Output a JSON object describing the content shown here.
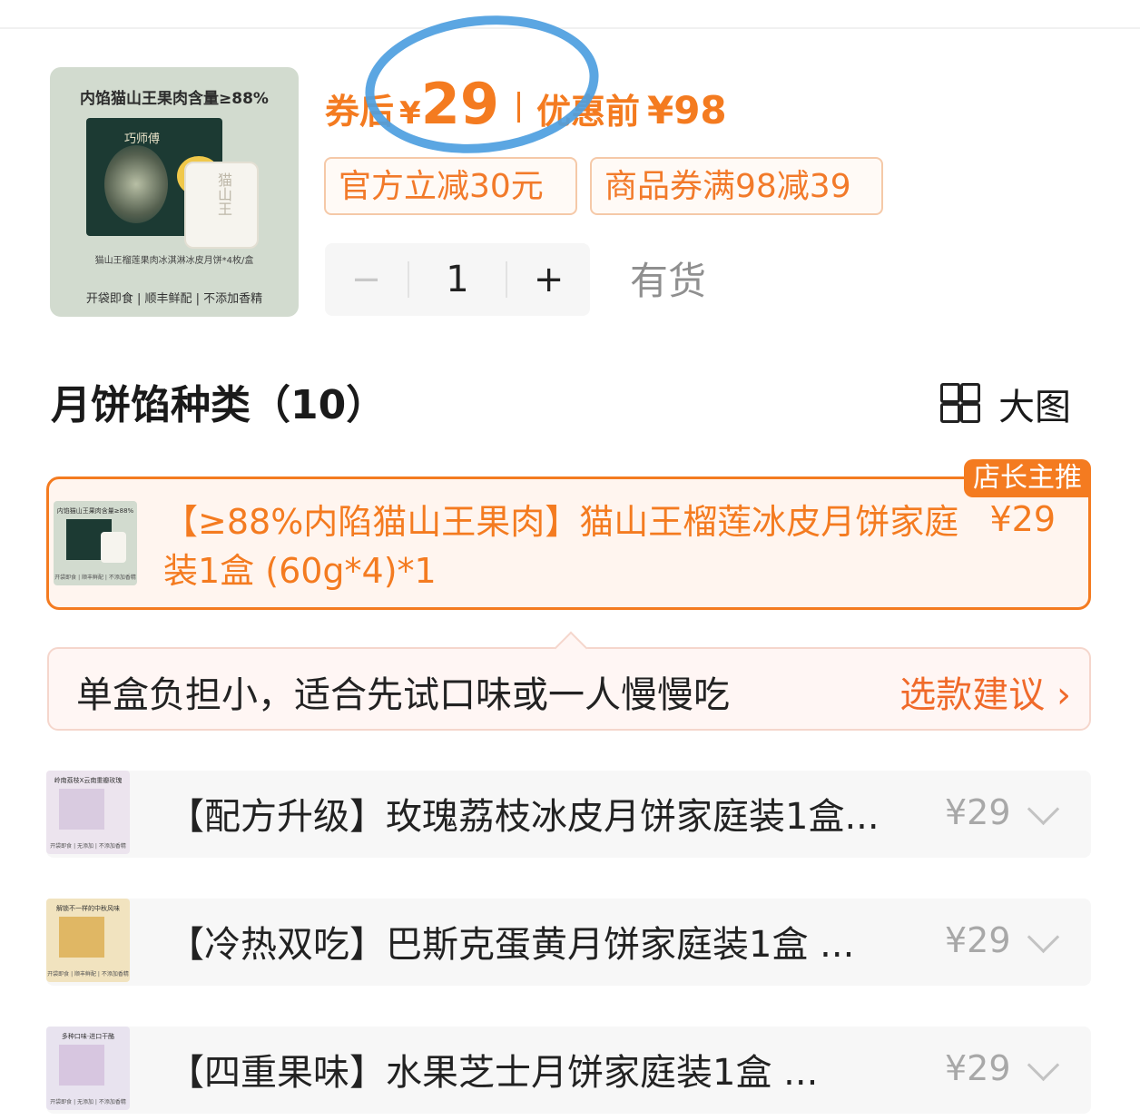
{
  "product": {
    "image_headline": "内馅猫山王果肉含量≥88%",
    "image_brand": "巧师傅",
    "image_cake_text": "猫山王",
    "image_caption": "猫山王榴莲果肉冰淇淋冰皮月饼*4枚/盒",
    "image_footer": "开袋即食 | 顺丰鲜配 | 不添加香精"
  },
  "price": {
    "label": "券后",
    "currency": "¥",
    "value": "29",
    "before_label": "优惠前",
    "before_value": "¥98"
  },
  "tags": [
    "官方立减30元",
    "商品券满98减39"
  ],
  "stepper": {
    "minus": "−",
    "value": "1",
    "plus": "+"
  },
  "stock": "有货",
  "section": {
    "title": "月饼馅种类（10）",
    "view_label": "大图"
  },
  "selected_option": {
    "badge": "店长主推",
    "thumb_title": "内馅猫山王果肉含量≥88%",
    "thumb_footer": "开袋即食 | 顺丰鲜配 | 不添加香精",
    "text": "【≥88%内陷猫山王果肉】猫山王榴莲冰皮月饼家庭装1盒 (60g*4)*1",
    "price": "¥29"
  },
  "tip": {
    "message": "单盒负担小，适合先试口味或一人慢慢吃",
    "suggest": "选款建议 ›"
  },
  "options": [
    {
      "thumb_title": "岭南荔枝X云南重瓣玫瑰",
      "thumb_footer": "开袋即食 | 无添加 | 不添加香精",
      "text": "【配方升级】玫瑰荔枝冰皮月饼家庭装1盒...",
      "price": "¥29",
      "color": "#ece4ee"
    },
    {
      "thumb_title": "解锁不一样的中秋风味",
      "thumb_footer": "开袋即食 | 顺丰鲜配 | 不添加香精",
      "text": "【冷热双吃】巴斯克蛋黄月饼家庭装1盒 ...",
      "price": "¥29",
      "color": "#f1e3bf"
    },
    {
      "thumb_title": "多种口味·进口干酪",
      "thumb_footer": "开袋即食 | 无添加 | 不添加香精",
      "text": "【四重果味】水果芝士月饼家庭装1盒 ...",
      "price": "¥29",
      "color": "#e8e3ef"
    }
  ],
  "colors": {
    "accent": "#f47b20",
    "circle": "#4d9ee0",
    "muted": "#a8a8a8"
  }
}
